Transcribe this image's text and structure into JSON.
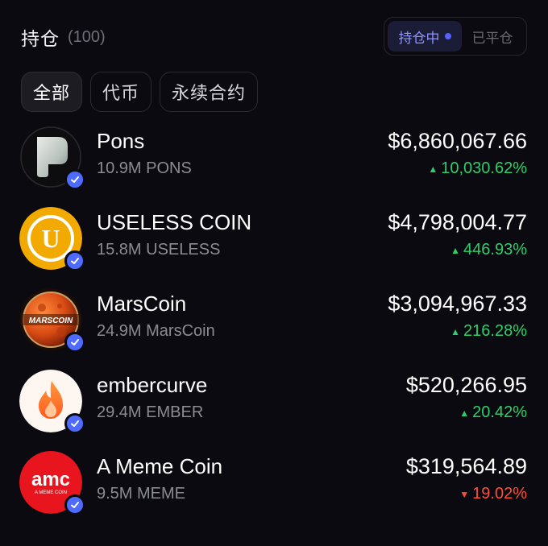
{
  "header": {
    "title": "持仓",
    "count": "(100)"
  },
  "status_toggle": {
    "active_label": "持仓中",
    "inactive_label": "已平仓"
  },
  "filters": [
    {
      "label": "全部",
      "active": true
    },
    {
      "label": "代币",
      "active": false
    },
    {
      "label": "永续合约",
      "active": false
    }
  ],
  "holdings": [
    {
      "name": "Pons",
      "amount": "10.9M PONS",
      "value": "$6,860,067.66",
      "change": "10,030.62%",
      "direction": "up",
      "icon": "pons-logo",
      "verified": true
    },
    {
      "name": "USELESS COIN",
      "amount": "15.8M USELESS",
      "value": "$4,798,004.77",
      "change": "446.93%",
      "direction": "up",
      "icon": "useless-coin-logo",
      "verified": true,
      "logo_text": "U"
    },
    {
      "name": "MarsCoin",
      "amount": "24.9M MarsCoin",
      "value": "$3,094,967.33",
      "change": "216.28%",
      "direction": "up",
      "icon": "marscoin-logo",
      "verified": true,
      "logo_text": "MARSCOIN"
    },
    {
      "name": "embercurve",
      "amount": "29.4M EMBER",
      "value": "$520,266.95",
      "change": "20.42%",
      "direction": "up",
      "icon": "ember-flame-logo",
      "verified": true
    },
    {
      "name": "A Meme Coin",
      "amount": "9.5M MEME",
      "value": "$319,564.89",
      "change": "19.02%",
      "direction": "down",
      "icon": "amc-logo",
      "verified": true,
      "logo_text": "amc",
      "logo_subtext": "A MEME COIN"
    }
  ],
  "colors": {
    "background": "#0b0a10",
    "up": "#2ecf6a",
    "down": "#ff4d3a",
    "accent": "#5561ff",
    "verified": "#4f6bff"
  }
}
